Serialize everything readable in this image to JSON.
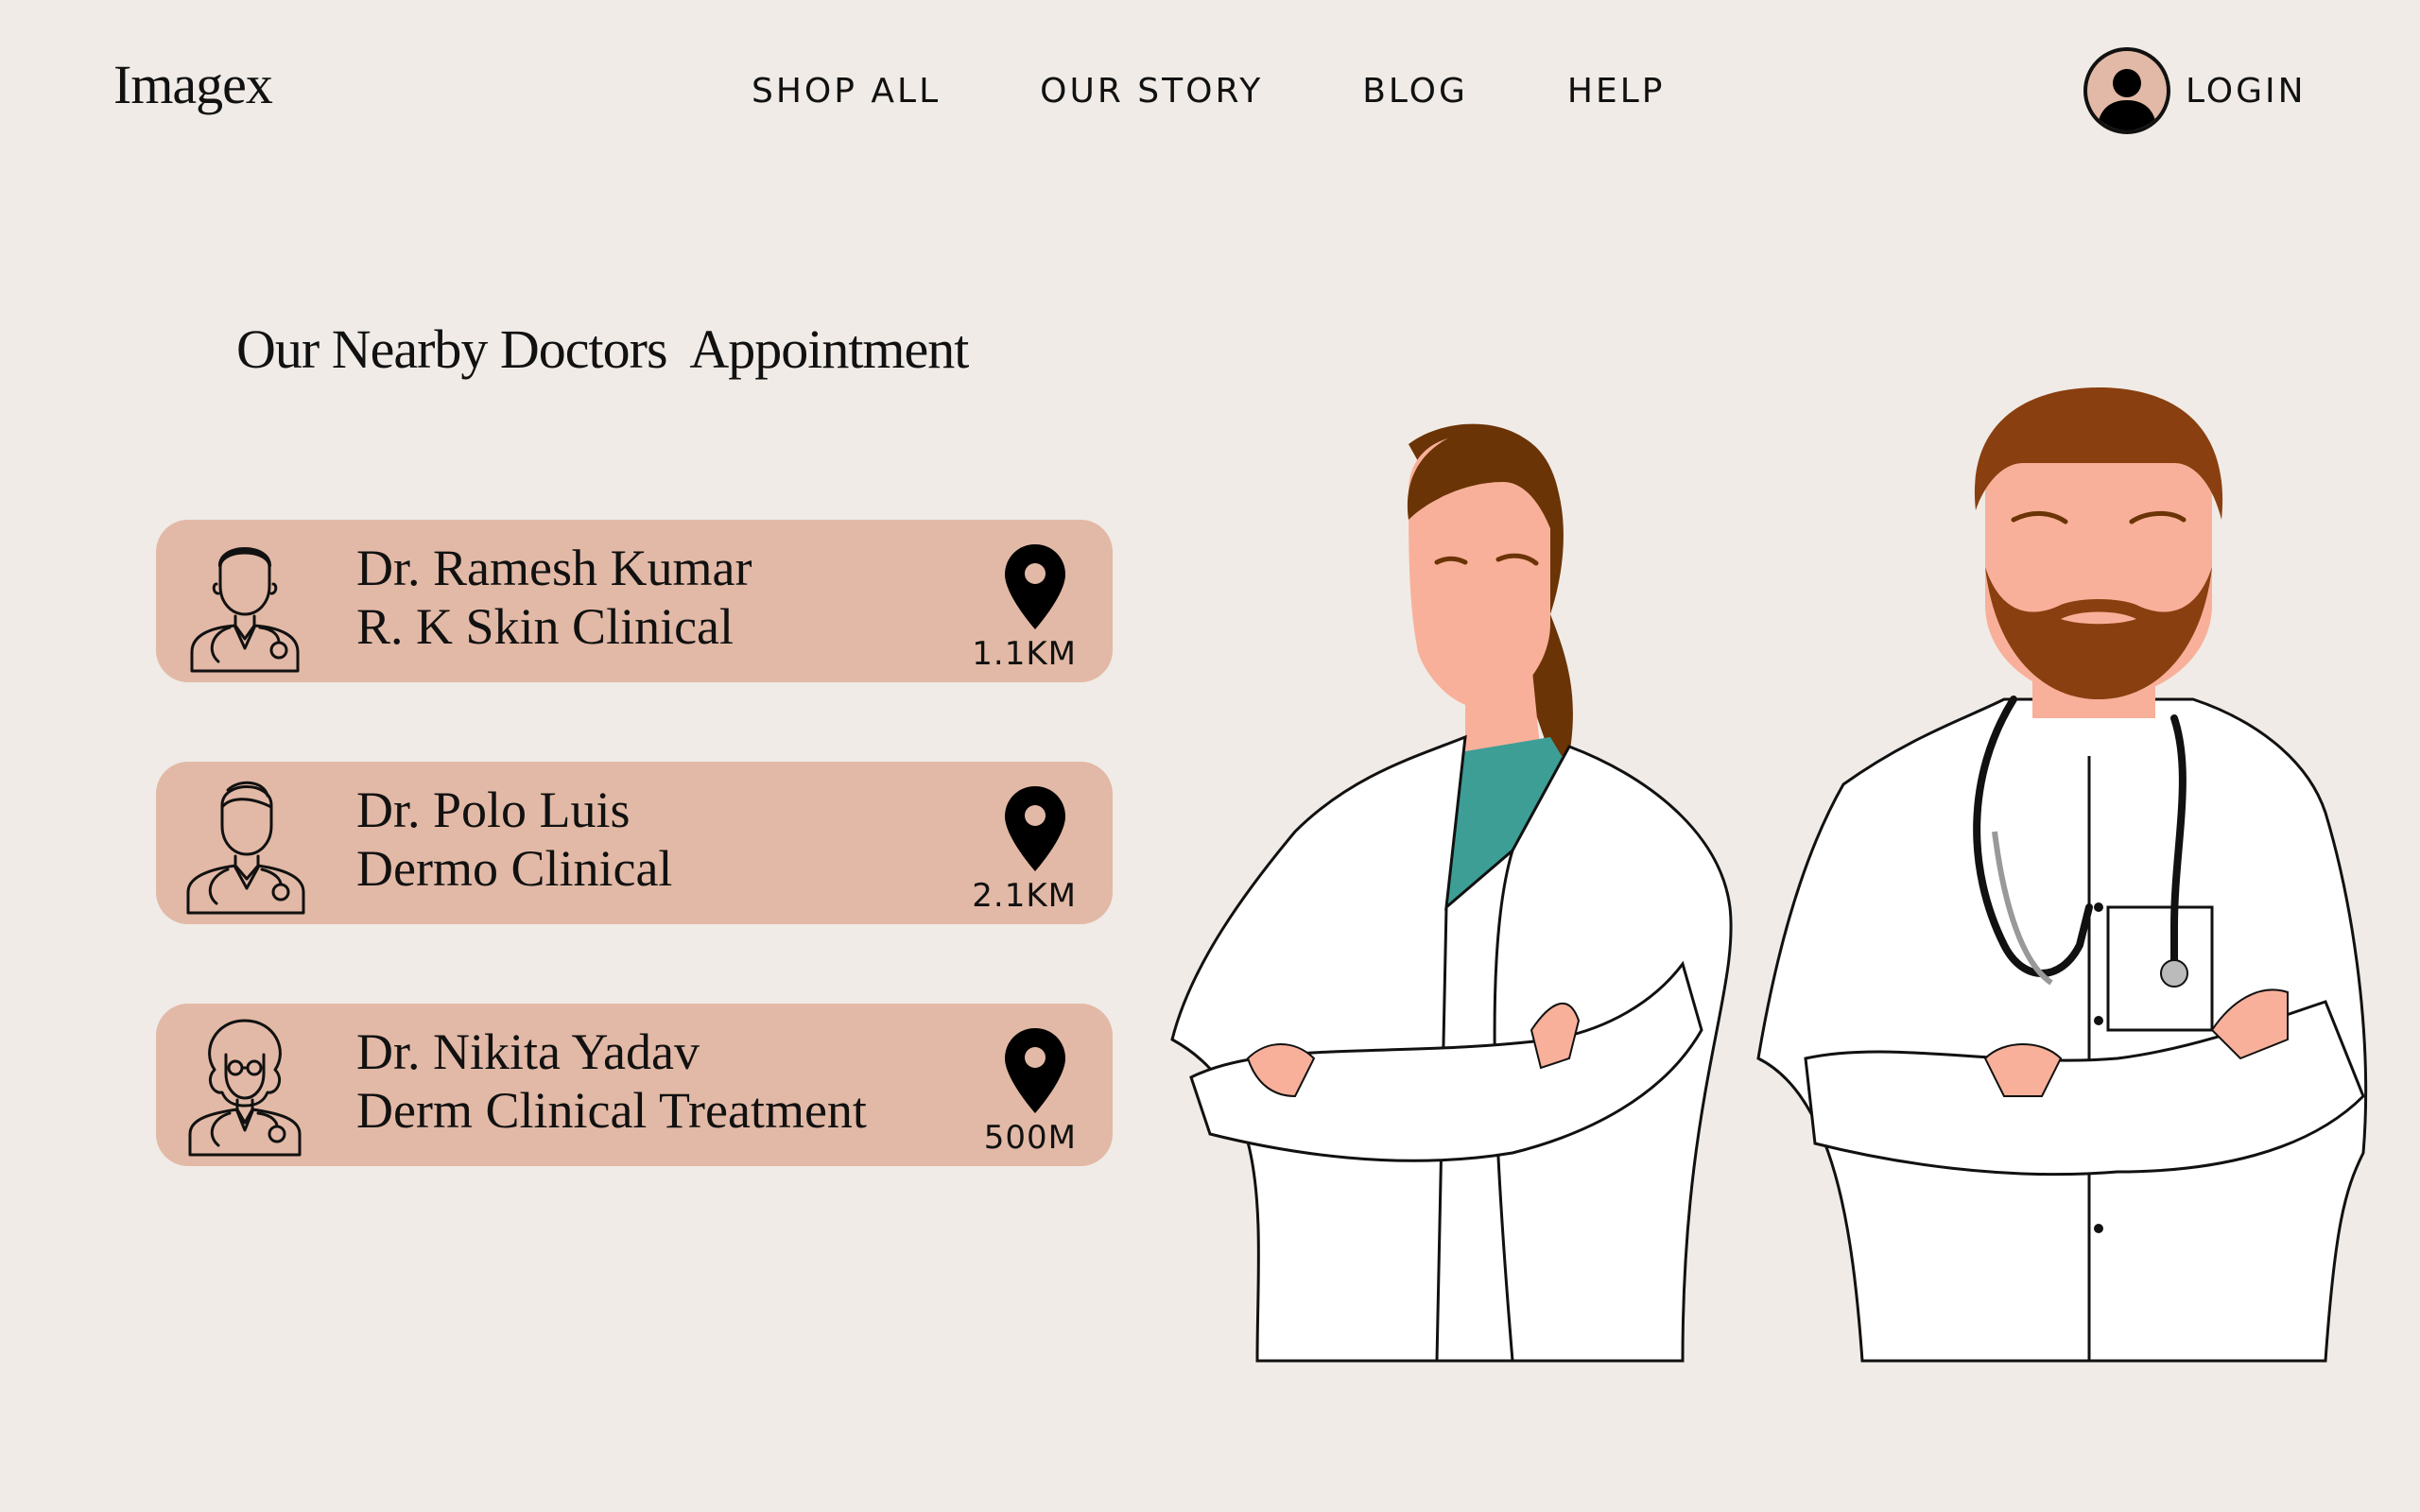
{
  "header": {
    "logo": "Imagex",
    "nav": [
      "SHOP ALL",
      "OUR STORY",
      "BLOG",
      "HELP"
    ],
    "login_label": "LOGIN"
  },
  "main": {
    "title": "Our Nearby Doctors  Appointment",
    "doctors": [
      {
        "name": "Dr. Ramesh Kumar",
        "clinic": "R. K Skin Clinical",
        "distance": "1.1KM",
        "icon": "male-doctor-icon"
      },
      {
        "name": "Dr. Polo Luis",
        "clinic": "Dermo Clinical",
        "distance": "2.1KM",
        "icon": "young-doctor-icon"
      },
      {
        "name": "Dr. Nikita Yadav",
        "clinic": "Derm Clinical Treatment",
        "distance": "500M",
        "icon": "female-doctor-icon"
      }
    ]
  },
  "colors": {
    "background": "#f0ebe6",
    "card": "#e2b9a6",
    "text": "#111111",
    "skin": "#f8b09a",
    "hair": "#6b3406",
    "scrub": "#3d9e96"
  }
}
